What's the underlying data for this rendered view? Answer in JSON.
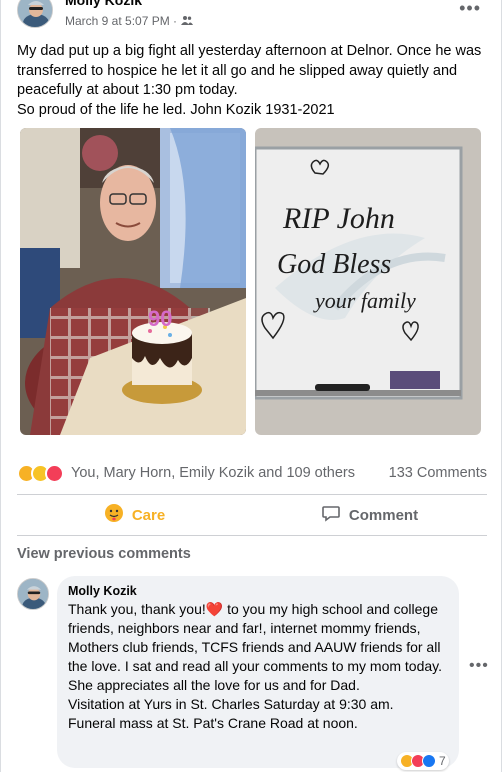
{
  "post": {
    "author": "Molly Kozik",
    "timestamp": "March 9 at 5:07 PM ·",
    "audience_icon": "friends-icon",
    "text_lines": [
      "My dad put up a big fight all yesterday afternoon at Delnor. Once he was transferred to hospice he let it all go and he slipped away quietly and peacefully at about 1:30 pm today.",
      "So proud of the life he led. John Kozik 1931-2021"
    ],
    "photos": [
      {
        "icon": "photo-birthday-cake",
        "cake_number": "90"
      },
      {
        "icon": "photo-whiteboard",
        "lines": [
          "RIP John",
          "God Bless",
          "your family"
        ]
      }
    ]
  },
  "reactions": {
    "icons": [
      "care-icon",
      "sad-icon",
      "love-icon"
    ],
    "names": "You, Mary Horn, Emily Kozik and 109 others",
    "comments_count": "133 Comments"
  },
  "actions": {
    "care_label": "Care",
    "comment_label": "Comment"
  },
  "comments": {
    "view_previous": "View previous comments",
    "items": [
      {
        "author": "Molly Kozik",
        "text_before_heart": "Thank you, thank you!",
        "heart": "❤️",
        "text_after_heart": " to you my high school and college friends, neighbors near and far!, internet mommy friends, Mothers club friends, TCFS friends and AAUW friends for all the love. I sat and read all your comments to my mom today. She appreciates all the love for us and for Dad.",
        "text_line2": "Visitation at Yurs in St. Charles Saturday at 9:30 am.",
        "text_line3": "Funeral mass at St. Pat's Crane Road at noon.",
        "reaction_count": "7"
      }
    ]
  },
  "colors": {
    "care": "#f7b125",
    "love": "#f33e58",
    "secondary_text": "#65676b",
    "bubble": "#f0f2f5"
  }
}
